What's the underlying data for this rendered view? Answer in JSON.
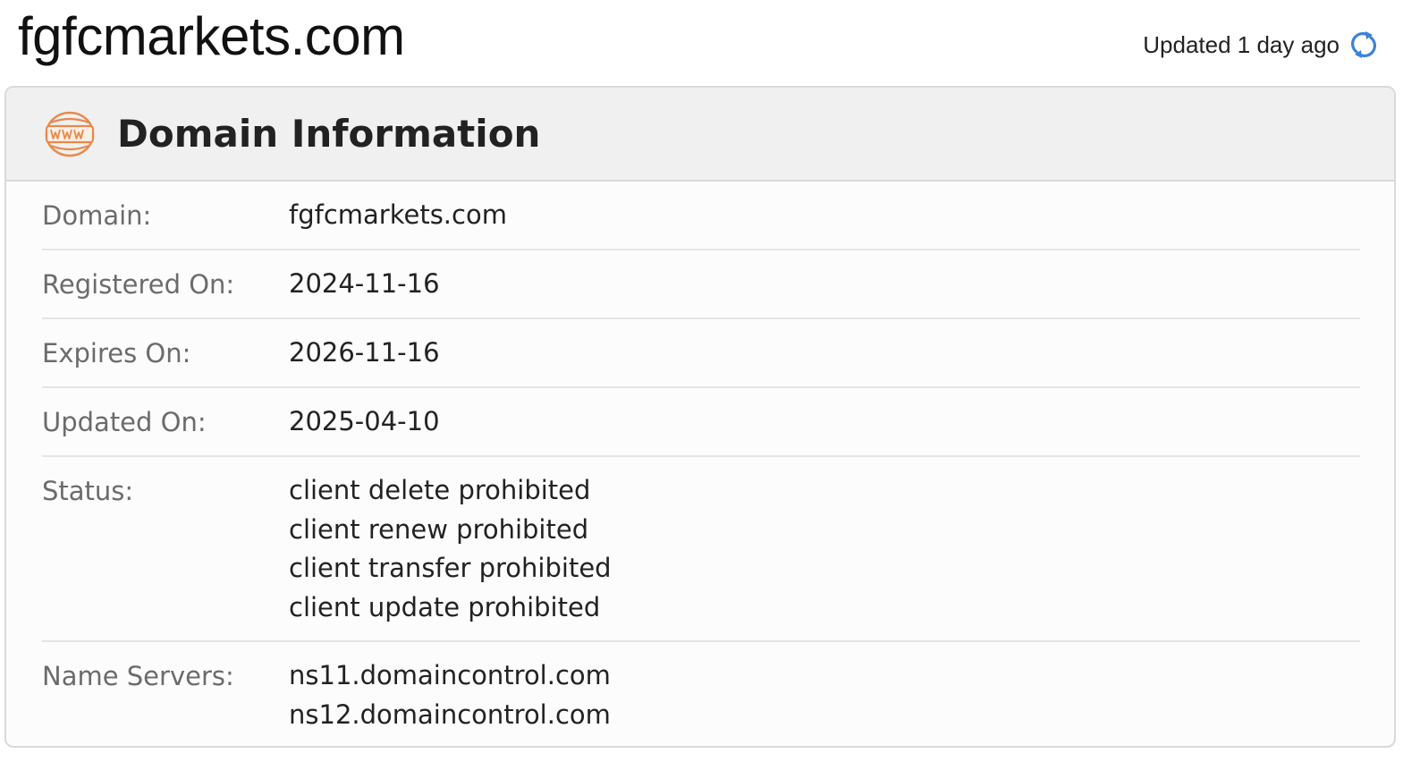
{
  "page": {
    "title": "fgfcmarkets.com",
    "updated_text": "Updated 1 day ago"
  },
  "card": {
    "title": "Domain Information",
    "icon": "www-globe-icon",
    "accent_color": "#e8894a"
  },
  "fields": {
    "domain": {
      "label": "Domain:",
      "value": "fgfcmarkets.com"
    },
    "registered": {
      "label": "Registered On:",
      "value": "2024-11-16"
    },
    "expires": {
      "label": "Expires On:",
      "value": "2026-11-16"
    },
    "updated": {
      "label": "Updated On:",
      "value": "2025-04-10"
    },
    "status": {
      "label": "Status:",
      "values": [
        "client delete prohibited",
        "client renew prohibited",
        "client transfer prohibited",
        "client update prohibited"
      ]
    },
    "name_servers": {
      "label": "Name Servers:",
      "values": [
        "ns11.domaincontrol.com",
        "ns12.domaincontrol.com"
      ]
    }
  },
  "colors": {
    "refresh_icon": "#3b82d6",
    "label_text": "#6b6b6b",
    "header_bg": "#f0f0f0"
  }
}
